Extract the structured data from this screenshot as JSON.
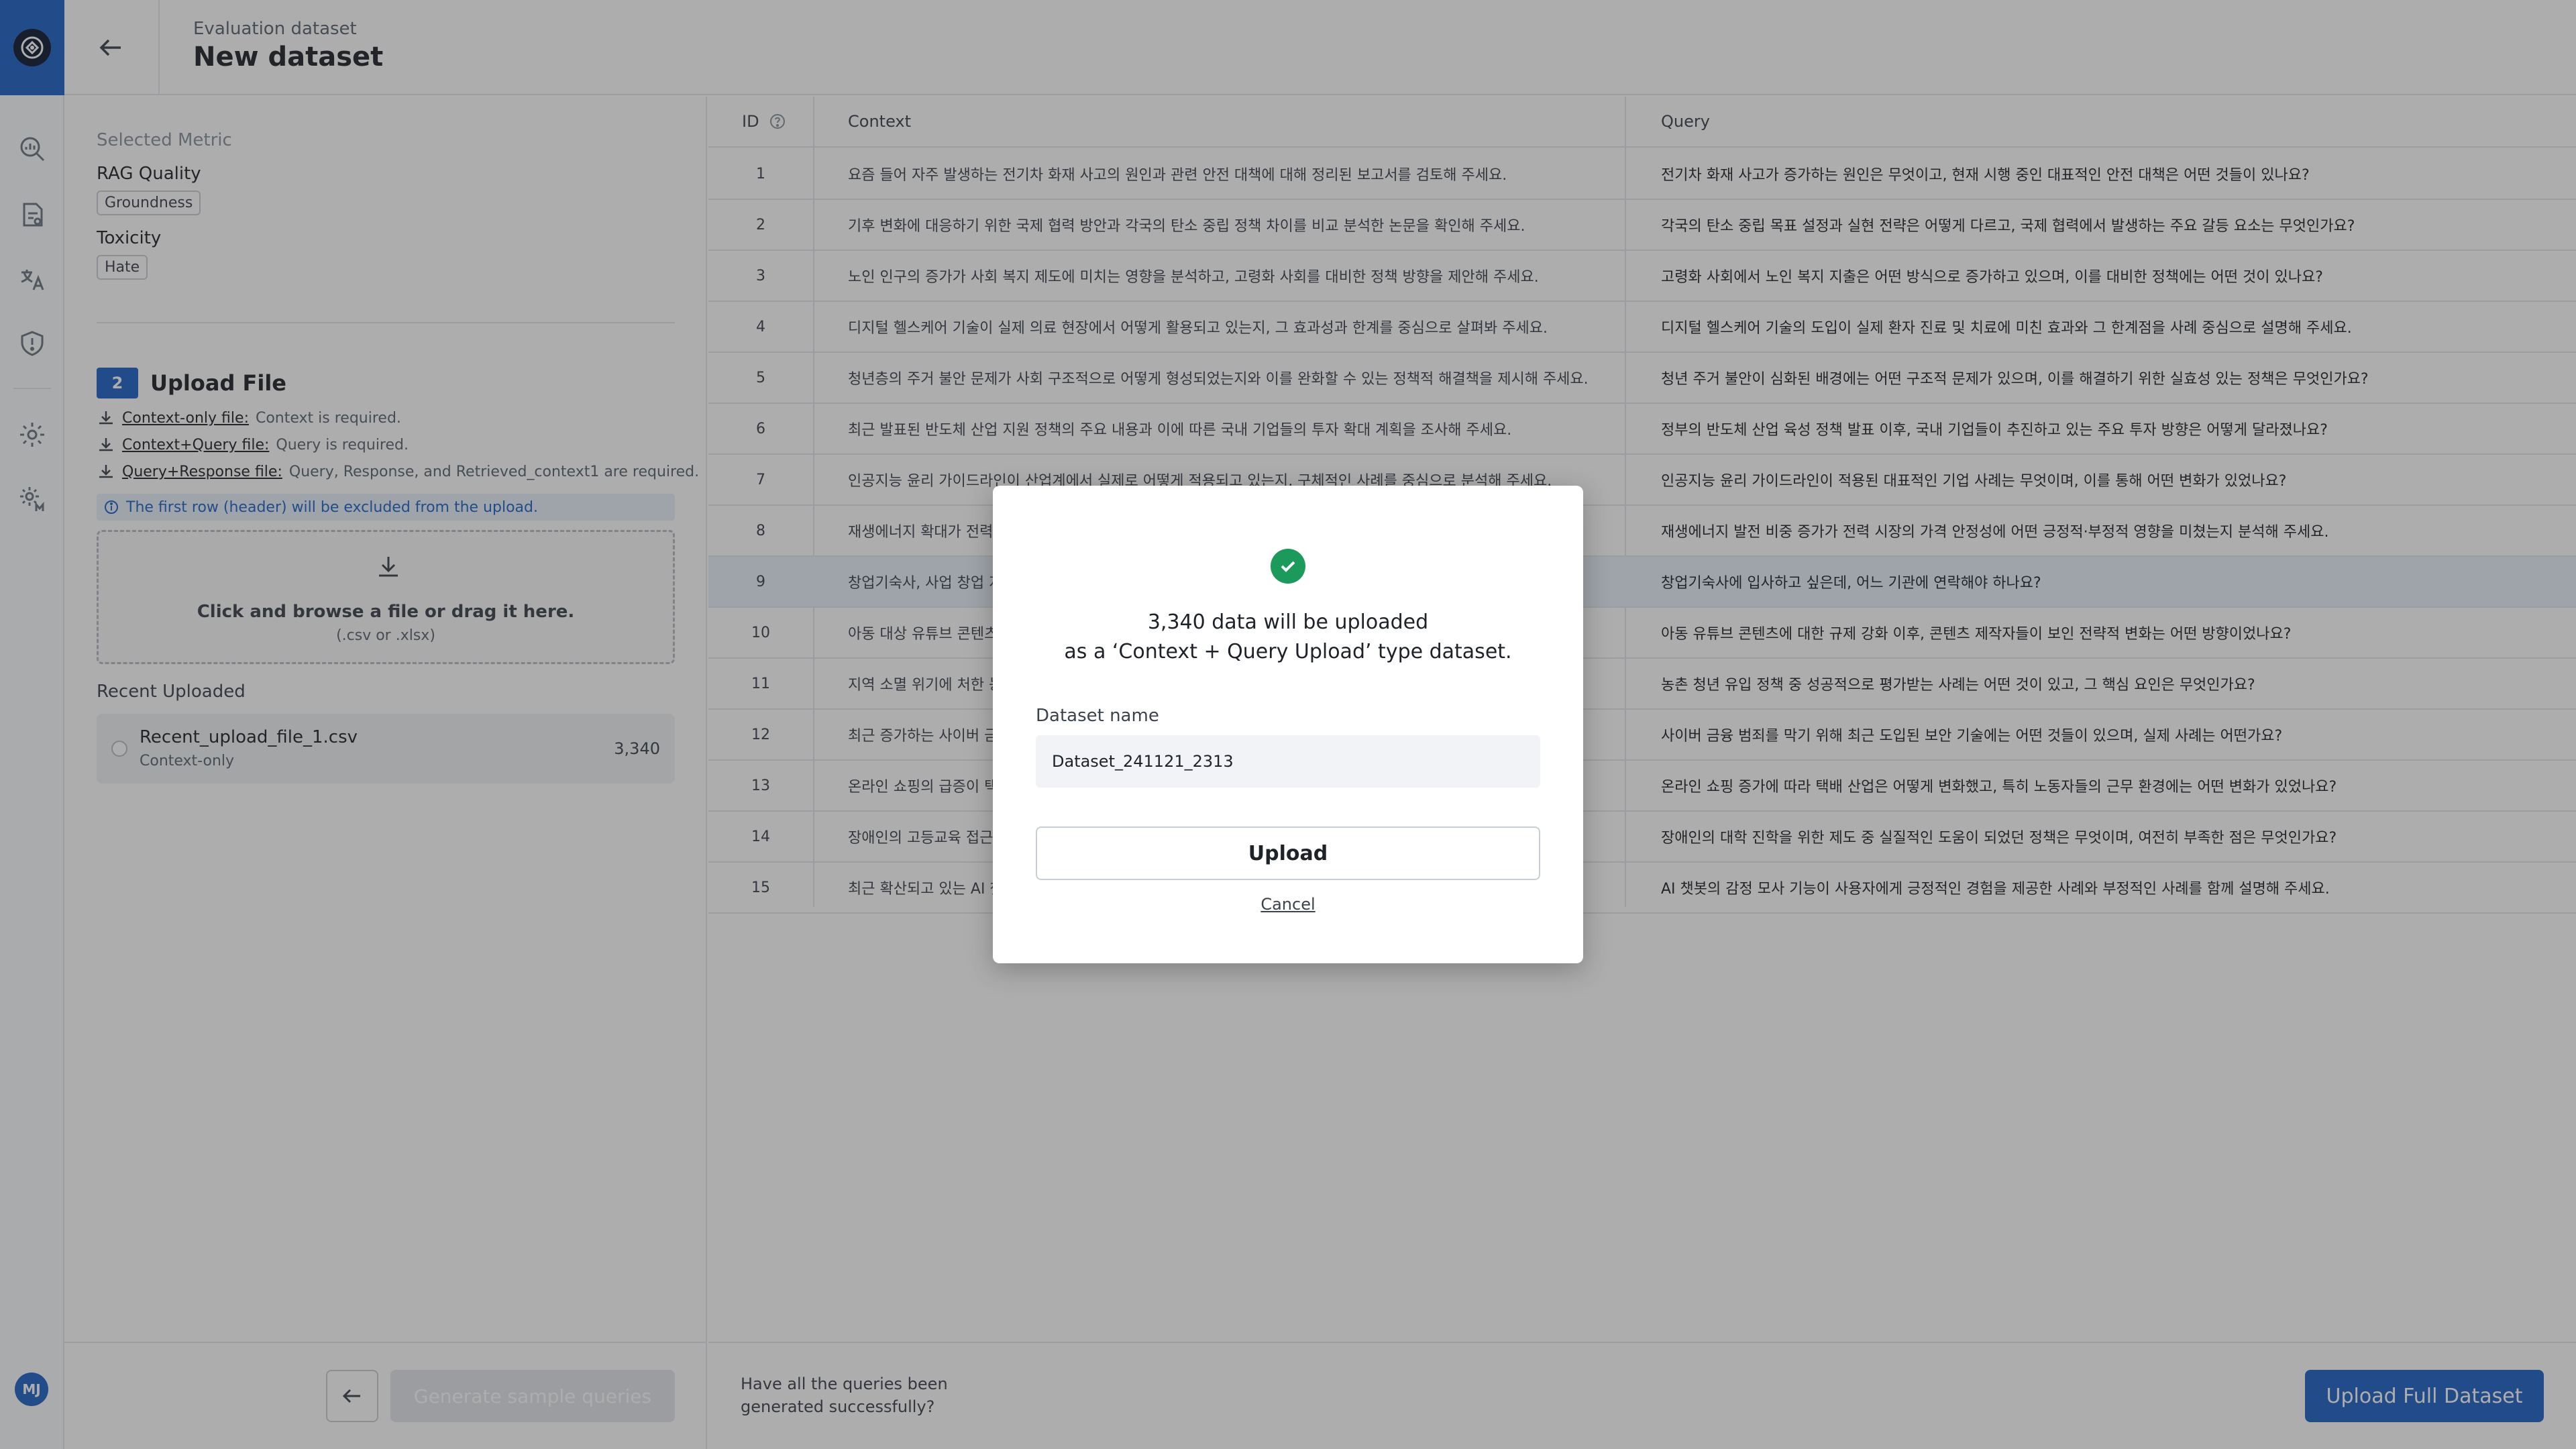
{
  "header": {
    "breadcrumb": "Evaluation dataset",
    "title": "New dataset"
  },
  "user": {
    "initials": "MJ"
  },
  "left_panel": {
    "selected_metric_label": "Selected Metric",
    "metrics": [
      {
        "group": "RAG Quality",
        "chip": "Groundness"
      },
      {
        "group": "Toxicity",
        "chip": "Hate"
      }
    ],
    "step_number": "2",
    "step_title": "Upload File",
    "requirements": [
      {
        "name": "Context-only file:",
        "desc": "Context is required."
      },
      {
        "name": "Context+Query file:",
        "desc": "Query is required."
      },
      {
        "name": "Query+Response file:",
        "desc": "Query, Response, and Retrieved_context1 are required."
      }
    ],
    "info_text": "The first row (header) will be excluded from the upload.",
    "dropzone_main": "Click and browse a file or drag it here.",
    "dropzone_sub": "(.csv or .xlsx)",
    "recent_title": "Recent Uploaded",
    "recent_file": {
      "name": "Recent_upload_file_1.csv",
      "type": "Context-only",
      "count": "3,340"
    }
  },
  "table": {
    "columns": [
      "ID",
      "Context",
      "Query"
    ],
    "rows": [
      {
        "id": "1",
        "context": "요즘 들어 자주 발생하는 전기차 화재 사고의 원인과 관련 안전 대책에 대해 정리된 보고서를 검토해 주세요.",
        "query": "전기차 화재 사고가 증가하는 원인은 무엇이고, 현재 시행 중인 대표적인 안전 대책은 어떤 것들이 있나요?"
      },
      {
        "id": "2",
        "context": "기후 변화에 대응하기 위한 국제 협력 방안과 각국의 탄소 중립 정책 차이를 비교 분석한 논문을 확인해 주세요.",
        "query": "각국의 탄소 중립 목표 설정과 실현 전략은 어떻게 다르고, 국제 협력에서 발생하는 주요 갈등 요소는 무엇인가요?"
      },
      {
        "id": "3",
        "context": "노인 인구의 증가가 사회 복지 제도에 미치는 영향을 분석하고, 고령화 사회를 대비한 정책 방향을 제안해 주세요.",
        "query": "고령화 사회에서 노인 복지 지출은 어떤 방식으로 증가하고 있으며, 이를 대비한 정책에는 어떤 것이 있나요?"
      },
      {
        "id": "4",
        "context": "디지털 헬스케어 기술이 실제 의료 현장에서 어떻게 활용되고 있는지, 그 효과성과 한계를 중심으로 살펴봐 주세요.",
        "query": "디지털 헬스케어 기술의 도입이 실제 환자 진료 및 치료에 미친 효과와 그 한계점을 사례 중심으로 설명해 주세요."
      },
      {
        "id": "5",
        "context": "청년층의 주거 불안 문제가 사회 구조적으로 어떻게 형성되었는지와 이를 완화할 수 있는 정책적 해결책을 제시해 주세요.",
        "query": "청년 주거 불안이 심화된 배경에는 어떤 구조적 문제가 있으며, 이를 해결하기 위한 실효성 있는 정책은 무엇인가요?"
      },
      {
        "id": "6",
        "context": "최근 발표된 반도체 산업 지원 정책의 주요 내용과 이에 따른 국내 기업들의 투자 확대 계획을 조사해 주세요.",
        "query": "정부의 반도체 산업 육성 정책 발표 이후, 국내 기업들이 추진하고 있는 주요 투자 방향은 어떻게 달라졌나요?"
      },
      {
        "id": "7",
        "context": "인공지능 윤리 가이드라인이 산업계에서 실제로 어떻게 적용되고 있는지, 구체적인 사례를 중심으로 분석해 주세요.",
        "query": "인공지능 윤리 가이드라인이 적용된 대표적인 기업 사례는 무엇이며, 이를 통해 어떤 변화가 있었나요?"
      },
      {
        "id": "8",
        "context": "재생에너지 확대가 전력 시장에 미치는 영향을 분석해 주세요.",
        "query": "재생에너지 발전 비중 증가가 전력 시장의 가격 안정성에 어떤 긍정적·부정적 영향을 미쳤는지 분석해 주세요."
      },
      {
        "id": "9",
        "context": "창업기숙사, 사업 창업 지원 정책과 관련하여 대한민국 국…",
        "query": "창업기숙사에 입사하고 싶은데, 어느 기관에 연락해야 하나요?"
      },
      {
        "id": "10",
        "context": "아동 대상 유튜브 콘텐츠 규제 강화 이후의 변화를 정리해 주세요.",
        "query": "아동 유튜브 콘텐츠에 대한 규제 강화 이후, 콘텐츠 제작자들이 보인 전략적 변화는 어떤 방향이었나요?"
      },
      {
        "id": "11",
        "context": "지역 소멸 위기에 처한 농촌의 청년 유입 정책을 검토해 주세요.",
        "query": "농촌 청년 유입 정책 중 성공적으로 평가받는 사례는 어떤 것이 있고, 그 핵심 요인은 무엇인가요?"
      },
      {
        "id": "12",
        "context": "최근 증가하는 사이버 금융 범죄 유형과 대응 기술을 조사해 주세요.",
        "query": "사이버 금융 범죄를 막기 위해 최근 도입된 보안 기술에는 어떤 것들이 있으며, 실제 사례는 어떤가요?"
      },
      {
        "id": "13",
        "context": "온라인 쇼핑의 급증이 택배 산업에 미친 영향을 분석해 주세요.",
        "query": "온라인 쇼핑 증가에 따라 택배 산업은 어떻게 변화했고, 특히 노동자들의 근무 환경에는 어떤 변화가 있었나요?"
      },
      {
        "id": "14",
        "context": "장애인의 고등교육 접근성 개선 정책을 검토해 주세요.",
        "query": "장애인의 대학 진학을 위한 제도 중 실질적인 도움이 되었던 정책은 무엇이며, 여전히 부족한 점은 무엇인가요?"
      },
      {
        "id": "15",
        "context": "최근 확산되고 있는 AI 챗봇의 감정 모사 기능에 대한 사례를 설명해 주세…",
        "query": "AI 챗봇의 감정 모사 기능이 사용자에게 긍정적인 경험을 제공한 사례와 부정적인 사례를 함께 설명해 주세요."
      }
    ]
  },
  "footer": {
    "generate_label": "Generate sample queries",
    "question": "Have all the queries been generated successfully?",
    "upload_full_label": "Upload Full Dataset"
  },
  "modal": {
    "line1": "3,340 data will be uploaded",
    "line2": "as a ‘Context + Query Upload’ type dataset.",
    "field_label": "Dataset name",
    "field_value": "Dataset_241121_2313",
    "upload_label": "Upload",
    "cancel_label": "Cancel"
  },
  "colors": {
    "accent": "#1f63c6",
    "success": "#1c9a5b",
    "highlight_row": "#e8f0fb"
  },
  "icons": {
    "rail": [
      "app-logo-icon",
      "analytics-icon",
      "report-icon",
      "translate-icon",
      "shield-icon",
      "settings-icon",
      "settings-model-icon"
    ],
    "header_back": "arrow-left-icon",
    "help": "question-circle-icon",
    "download": "download-icon",
    "info": "info-circle-icon",
    "success": "check-circle-icon"
  }
}
